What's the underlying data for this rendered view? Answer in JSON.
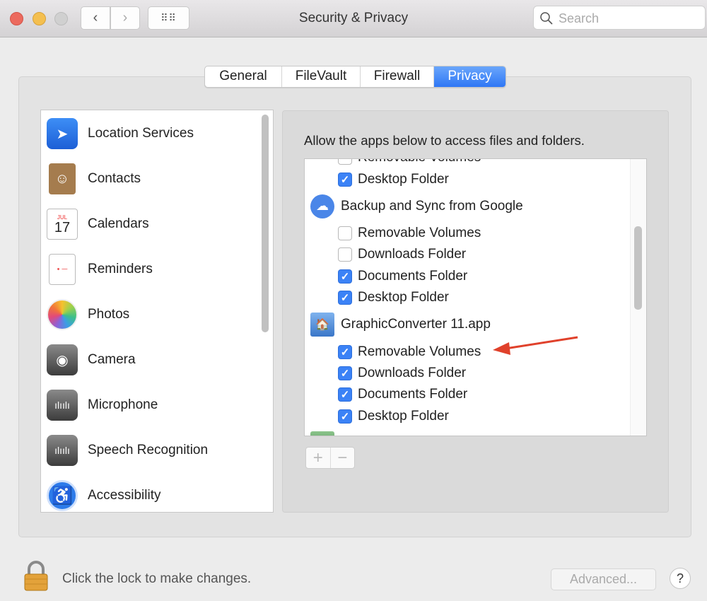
{
  "window": {
    "title": "Security & Privacy",
    "search_placeholder": "Search"
  },
  "tabs": [
    {
      "label": "General"
    },
    {
      "label": "FileVault"
    },
    {
      "label": "Firewall"
    },
    {
      "label": "Privacy",
      "active": true
    }
  ],
  "sidebar": {
    "items": [
      {
        "label": "Location Services",
        "icon": "location-arrow-icon"
      },
      {
        "label": "Contacts",
        "icon": "contacts-book-icon"
      },
      {
        "label": "Calendars",
        "icon": "calendar-icon",
        "month": "JUL",
        "day": "17"
      },
      {
        "label": "Reminders",
        "icon": "reminders-icon"
      },
      {
        "label": "Photos",
        "icon": "photos-flower-icon"
      },
      {
        "label": "Camera",
        "icon": "camera-icon"
      },
      {
        "label": "Microphone",
        "icon": "microphone-waveform-icon"
      },
      {
        "label": "Speech Recognition",
        "icon": "speech-waveform-icon"
      },
      {
        "label": "Accessibility",
        "icon": "accessibility-icon"
      }
    ]
  },
  "main": {
    "description": "Allow the apps below to access files and folders.",
    "rows": [
      {
        "type": "check",
        "label": "Removable Volumes",
        "checked": false
      },
      {
        "type": "check",
        "label": "Desktop Folder",
        "checked": true
      },
      {
        "type": "app",
        "label": "Backup and Sync from Google",
        "icon": "cloud-upload-icon"
      },
      {
        "type": "check",
        "label": "Removable Volumes",
        "checked": false
      },
      {
        "type": "check",
        "label": "Downloads Folder",
        "checked": false
      },
      {
        "type": "check",
        "label": "Documents Folder",
        "checked": true
      },
      {
        "type": "check",
        "label": "Desktop Folder",
        "checked": true
      },
      {
        "type": "app",
        "label": "GraphicConverter 11.app",
        "icon": "graphicconverter-icon"
      },
      {
        "type": "check",
        "label": "Removable Volumes",
        "checked": true,
        "annotated": true
      },
      {
        "type": "check",
        "label": "Downloads Folder",
        "checked": true
      },
      {
        "type": "check",
        "label": "Documents Folder",
        "checked": true
      },
      {
        "type": "check",
        "label": "Desktop Folder",
        "checked": true
      },
      {
        "type": "app",
        "label": "",
        "icon": "app-icon"
      }
    ],
    "add_label": "+",
    "remove_label": "−"
  },
  "footer": {
    "lock_text": "Click the lock to make changes.",
    "advanced_label": "Advanced...",
    "help_label": "?"
  },
  "colors": {
    "accent": "#3b82f6",
    "annotation_arrow": "#e0412b"
  }
}
